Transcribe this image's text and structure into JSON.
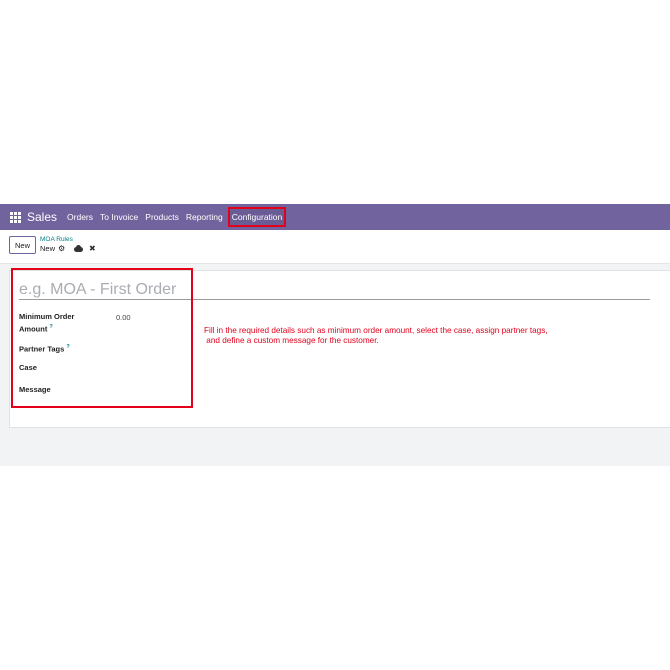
{
  "navbar": {
    "brand": "Sales",
    "items": [
      "Orders",
      "To Invoice",
      "Products",
      "Reporting",
      "Configuration"
    ]
  },
  "control": {
    "new_label": "New",
    "breadcrumb": "MOA Rules",
    "record_title": "New"
  },
  "form": {
    "name_placeholder": "e.g. MOA - First Order",
    "min_order_label_line1": "Minimum Order",
    "min_order_label_line2": "Amount",
    "min_order_value": "0.00",
    "partner_tags_label": "Partner Tags",
    "case_label": "Case",
    "message_label": "Message",
    "tooltip_mark": "?"
  },
  "note": {
    "line1": "Fill in the required details such as minimum order amount, select the case, assign partner tags,",
    "line2": " and define a custom message for the customer."
  },
  "colors": {
    "navbar": "#71639e",
    "highlight": "#e3001b",
    "link": "#017e84"
  }
}
